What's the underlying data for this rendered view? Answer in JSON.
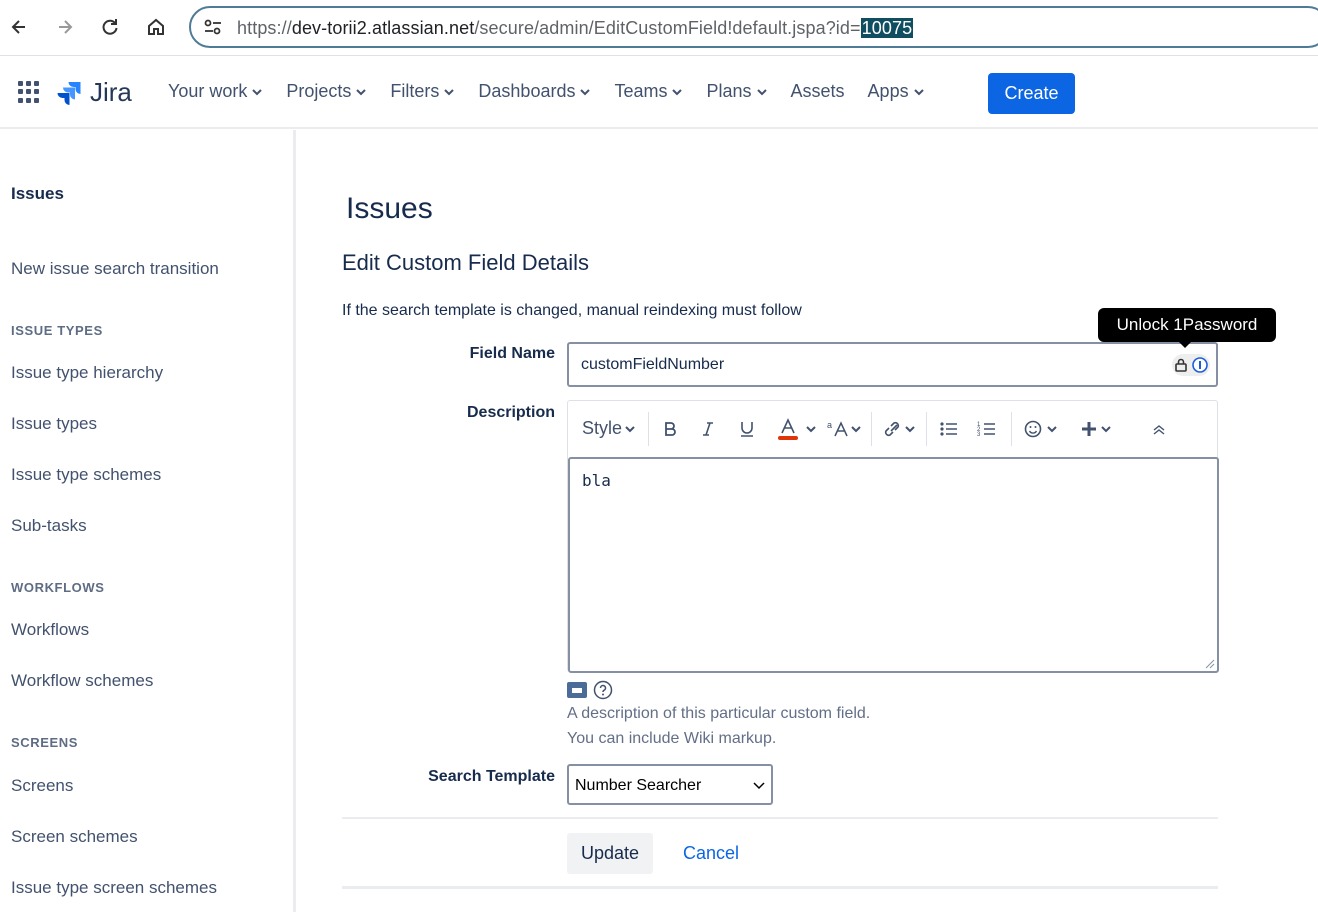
{
  "browser": {
    "url_prefix": "https://",
    "url_host": "dev-torii2.atlassian.net",
    "url_path": "/secure/admin/EditCustomField!default.jspa?id=",
    "url_selected": "10075"
  },
  "topnav": {
    "logo_text": "Jira",
    "menu": [
      {
        "label": "Your work",
        "has_dropdown": true
      },
      {
        "label": "Projects",
        "has_dropdown": true
      },
      {
        "label": "Filters",
        "has_dropdown": true
      },
      {
        "label": "Dashboards",
        "has_dropdown": true
      },
      {
        "label": "Teams",
        "has_dropdown": true
      },
      {
        "label": "Plans",
        "has_dropdown": true
      },
      {
        "label": "Assets",
        "has_dropdown": false
      },
      {
        "label": "Apps",
        "has_dropdown": true
      }
    ],
    "create_label": "Create",
    "accent": "#0c66e4"
  },
  "sidebar": {
    "title": "Issues",
    "items": {
      "new_issue_search": "New issue search transition",
      "section_issue_types": "ISSUE TYPES",
      "issue_type_hierarchy": "Issue type hierarchy",
      "issue_types": "Issue types",
      "issue_type_schemes": "Issue type schemes",
      "sub_tasks": "Sub-tasks",
      "section_workflows": "WORKFLOWS",
      "workflows": "Workflows",
      "workflow_schemes": "Workflow schemes",
      "section_screens": "SCREENS",
      "screens": "Screens",
      "screen_schemes": "Screen schemes",
      "issue_type_screen_schemes": "Issue type screen schemes"
    }
  },
  "main": {
    "page_title": "Issues",
    "section_title": "Edit Custom Field Details",
    "notice": "If the search template is changed, manual reindexing must follow",
    "field_name_label": "Field Name",
    "field_name_value": "customFieldNumber",
    "tooltip": "Unlock 1Password",
    "description_label": "Description",
    "editor_style_label": "Style",
    "description_value": "bla",
    "help_line1": "A description of this particular custom field.",
    "help_line2": "You can include Wiki markup.",
    "search_template_label": "Search Template",
    "search_template_value": "Number Searcher",
    "update_label": "Update",
    "cancel_label": "Cancel"
  }
}
